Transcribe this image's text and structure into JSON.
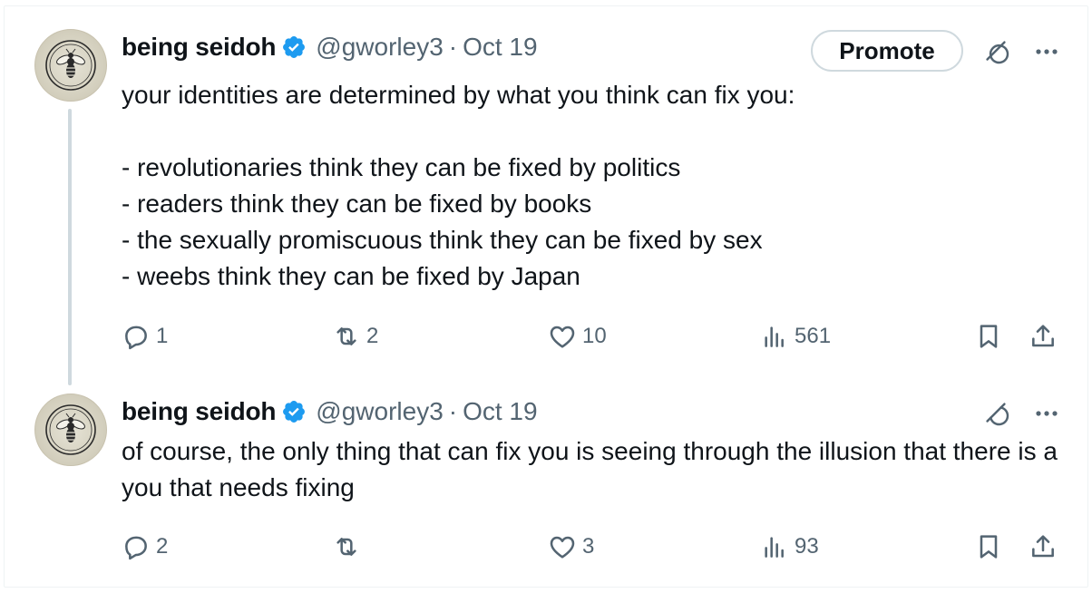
{
  "promote_label": "Promote",
  "tweets": [
    {
      "display_name": "being seidoh",
      "handle": "@gworley3",
      "separator": "·",
      "date": "Oct 19",
      "text": "your identities are determined by what you think can fix you:\n\n- revolutionaries think they can be fixed by politics\n- readers think they can be fixed by books\n- the sexually promiscuous think they can be fixed by sex\n- weebs think they can be fixed by Japan",
      "replies": "1",
      "retweets": "2",
      "likes": "10",
      "views": "561"
    },
    {
      "display_name": "being seidoh",
      "handle": "@gworley3",
      "separator": "·",
      "date": "Oct 19",
      "text": "of course, the only thing that can fix you is seeing through the illusion that there is a you that needs fixing",
      "replies": "2",
      "retweets": "",
      "likes": "3",
      "views": "93"
    }
  ],
  "colors": {
    "verified_blue": "#1d9bf0",
    "secondary_text": "#536471",
    "thread_line": "#cfd9de"
  },
  "icons": {
    "avatar": "bee-emblem-avatar",
    "verified": "verified-badge-icon",
    "grok": "grok-icon",
    "more": "more-icon",
    "reply": "reply-icon",
    "retweet": "retweet-icon",
    "like": "heart-icon",
    "views": "views-icon",
    "bookmark": "bookmark-icon",
    "share": "share-icon"
  }
}
